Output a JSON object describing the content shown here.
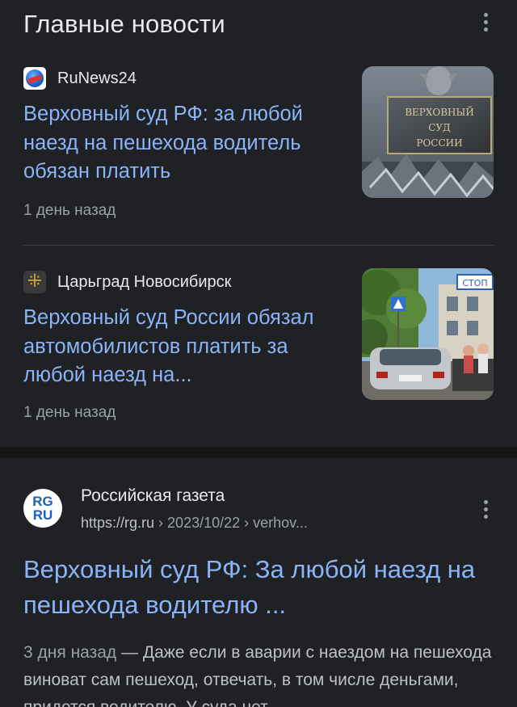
{
  "top_stories": {
    "title": "Главные новости",
    "stories": [
      {
        "source": "RuNews24",
        "title": "Верховный суд РФ: за любой наезд на пешехода водитель обязан платить",
        "time": "1 день назад",
        "thumbnail_icon": "court-sign-photo",
        "thumbnail_text": [
          "ВЕРХОВНЫЙ",
          "СУД",
          "РОССИИ"
        ]
      },
      {
        "source": "Царьград Новосибирск",
        "title": "Верховный суд России обязал автомобилистов платить за любой наезд на...",
        "time": "1 день назад",
        "thumbnail_icon": "street-car-photo",
        "thumbnail_text": [
          "СТОП"
        ]
      }
    ]
  },
  "result": {
    "favicon": {
      "line1": "RG",
      "line2": "RU"
    },
    "site_name": "Российская газета",
    "url_domain": "https://rg.ru",
    "url_path": " › 2023/10/22 › verhov...",
    "title": "Верховный суд РФ: За любой наезд на пешехода водителю ...",
    "date": "3 дня назад",
    "snippet": " — Даже если в аварии с наездом на пешехода виноват сам пешеход, отвечать, в том числе деньгами, придется водителю. У суда нет"
  },
  "colors": {
    "background": "#202124",
    "link": "#8ab4f8",
    "text_primary": "#e8eaed",
    "text_secondary": "#9aa0a6"
  }
}
